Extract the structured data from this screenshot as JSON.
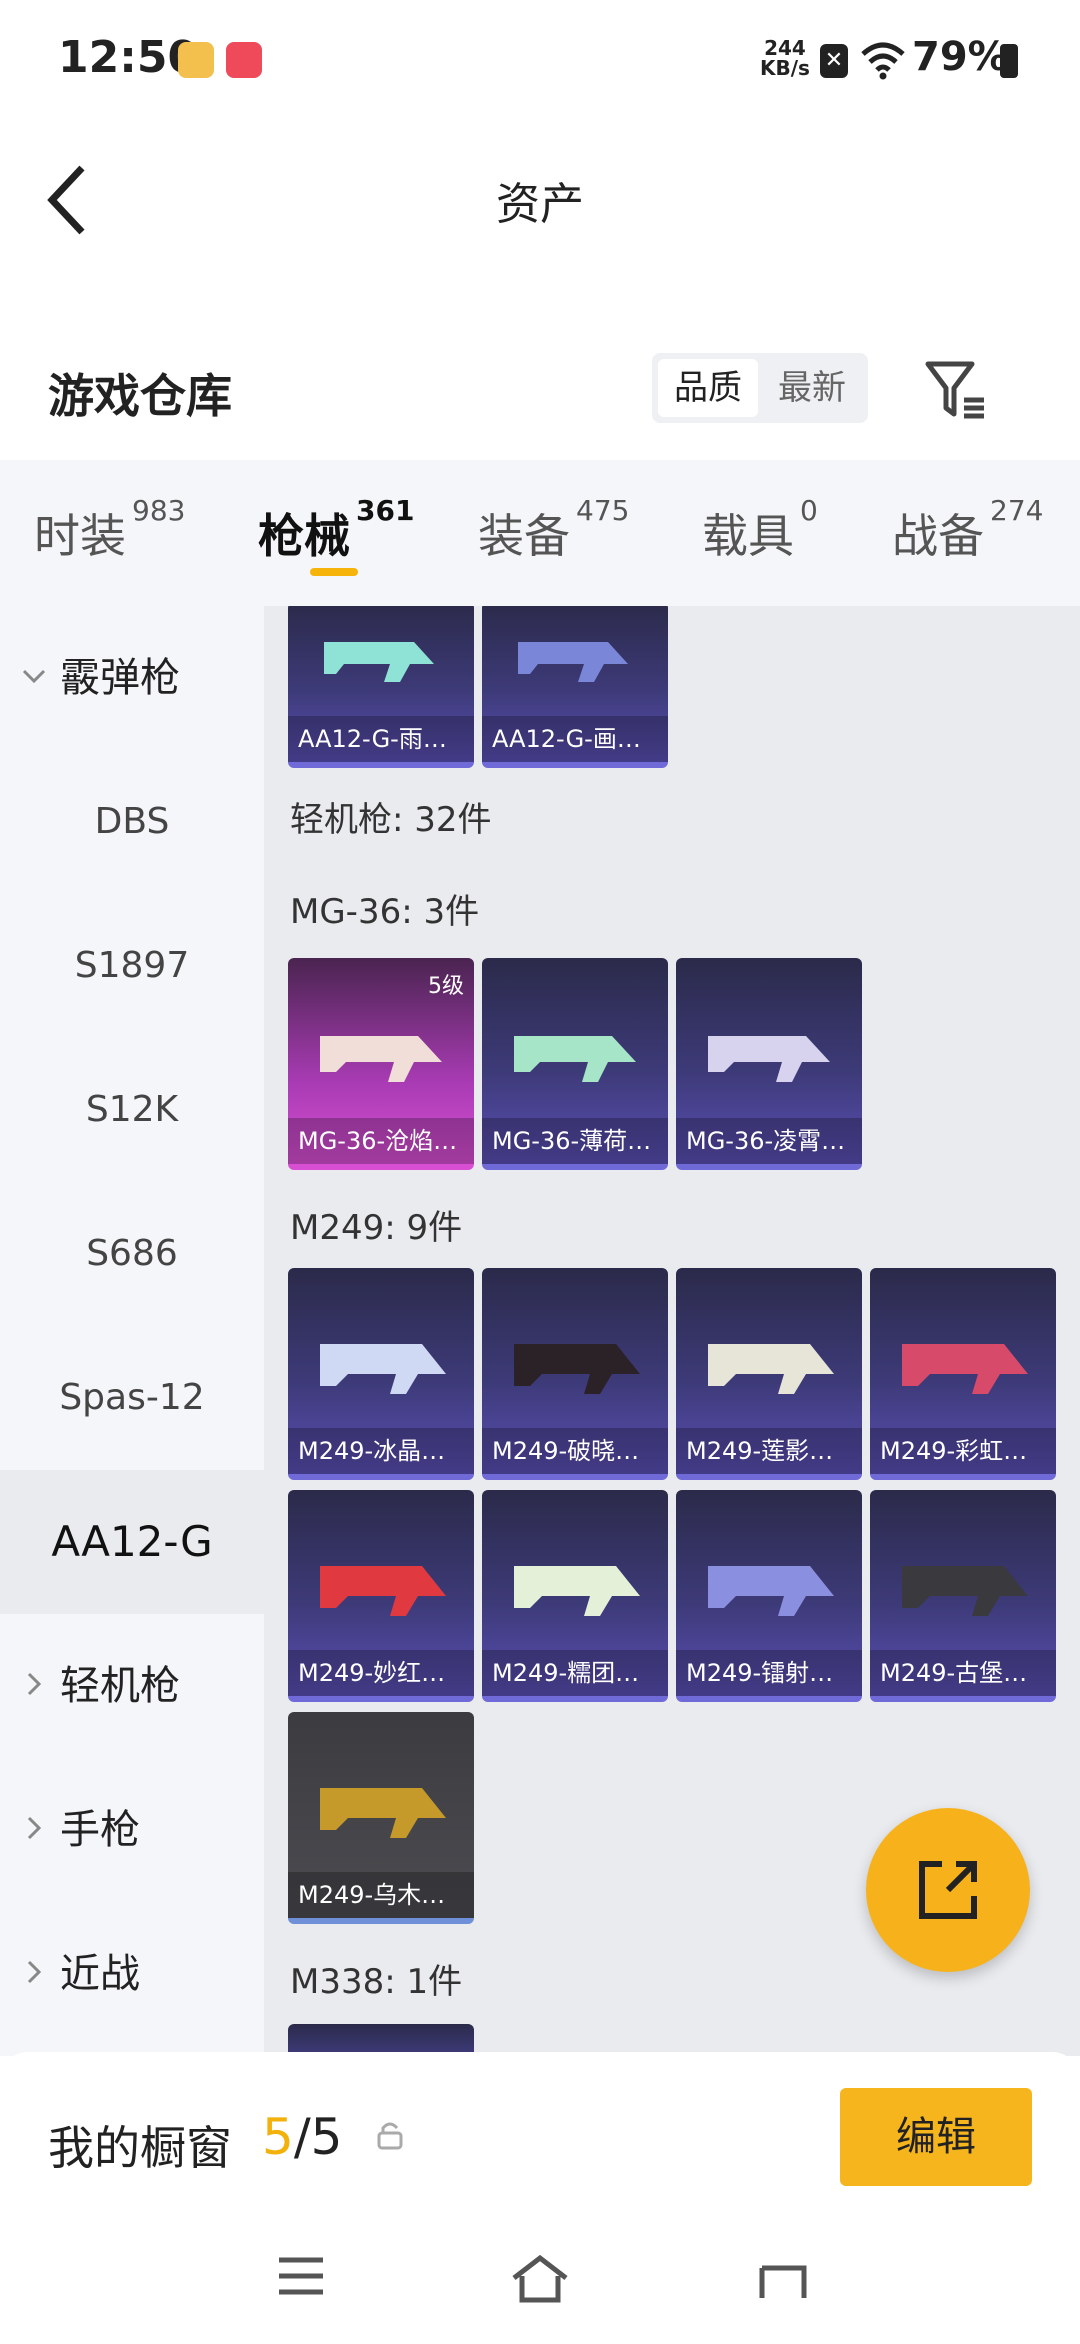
{
  "status": {
    "time": "12:50",
    "speed_value": "244",
    "speed_unit": "KB/s",
    "battery": "79%"
  },
  "header": {
    "title": "资产"
  },
  "warehouse": {
    "title": "游戏仓库",
    "sort_options": [
      "品质",
      "最新"
    ],
    "selected_sort": "品质"
  },
  "tabs": [
    {
      "label": "时装",
      "count": "983"
    },
    {
      "label": "枪械",
      "count": "361"
    },
    {
      "label": "装备",
      "count": "475"
    },
    {
      "label": "载具",
      "count": "0"
    },
    {
      "label": "战备",
      "count": "274"
    }
  ],
  "active_tab": "枪械",
  "sidebar": [
    {
      "label": "霰弹枪",
      "type": "group",
      "expanded": true
    },
    {
      "label": "DBS",
      "type": "item"
    },
    {
      "label": "S1897",
      "type": "item"
    },
    {
      "label": "S12K",
      "type": "item"
    },
    {
      "label": "S686",
      "type": "item"
    },
    {
      "label": "Spas-12",
      "type": "item"
    },
    {
      "label": "AA12-G",
      "type": "item",
      "active": true
    },
    {
      "label": "轻机枪",
      "type": "group",
      "expanded": false
    },
    {
      "label": "手枪",
      "type": "group",
      "expanded": false
    },
    {
      "label": "近战",
      "type": "group",
      "expanded": false
    }
  ],
  "content": {
    "top_cards": [
      "AA12-G-雨…",
      "AA12-G-画…"
    ],
    "category_label": "轻机枪: 32件",
    "mg36": {
      "label": "MG-36: 3件",
      "cards": [
        {
          "name": "MG-36-沧焰…",
          "level": "5级"
        },
        {
          "name": "MG-36-薄荷…"
        },
        {
          "name": "MG-36-凌霄…"
        }
      ]
    },
    "m249": {
      "label": "M249: 9件",
      "cards": [
        "M249-冰晶…",
        "M249-破晓…",
        "M249-莲影…",
        "M249-彩虹…",
        "M249-妙红…",
        "M249-糯团…",
        "M249-镭射…",
        "M249-古堡…",
        "M249-乌木…"
      ]
    },
    "m338": {
      "label": "M338: 1件"
    }
  },
  "showcase": {
    "title": "我的橱窗",
    "current": "5",
    "total": "/5",
    "edit_label": "编辑"
  },
  "colors": {
    "accent": "#f7b21b",
    "card_blue": "#3d3a78",
    "card_legend": "#a83bb3"
  }
}
